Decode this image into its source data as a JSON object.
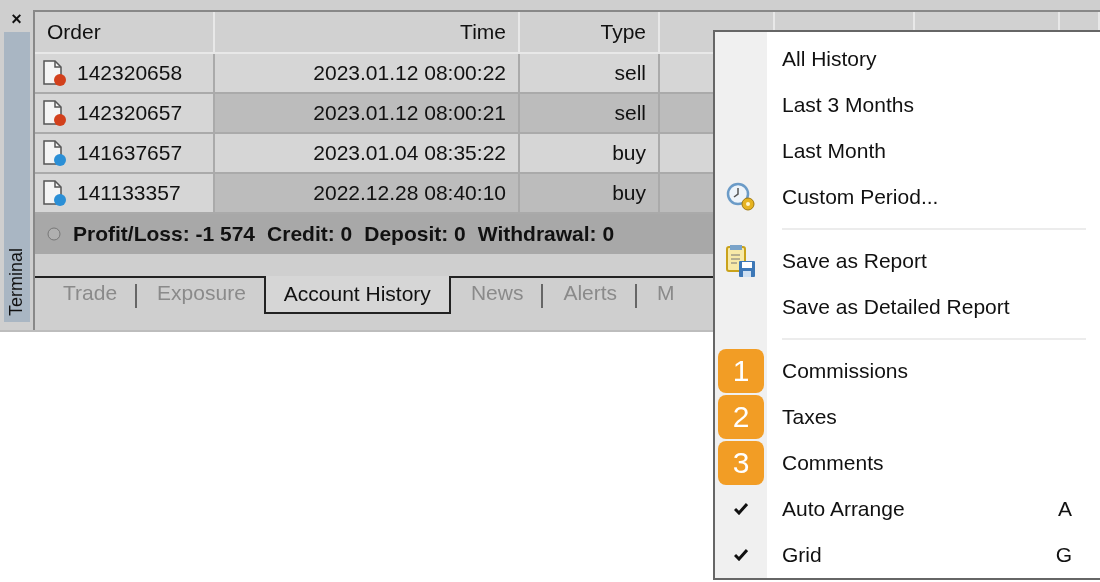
{
  "panel": {
    "title": "Terminal",
    "close": "×"
  },
  "table": {
    "columns": [
      {
        "label": "Order"
      },
      {
        "label": "Time"
      },
      {
        "label": "Type"
      },
      {},
      {},
      {},
      {}
    ],
    "rows": [
      {
        "order": "142320658",
        "time": "2023.01.12 08:00:22",
        "type": "sell",
        "color": "#d2401c"
      },
      {
        "order": "142320657",
        "time": "2023.01.12 08:00:21",
        "type": "sell",
        "color": "#d2401c"
      },
      {
        "order": "141637657",
        "time": "2023.01.04 08:35:22",
        "type": "buy",
        "color": "#2b8fd6"
      },
      {
        "order": "141133357",
        "time": "2022.12.28 08:40:10",
        "type": "buy",
        "color": "#2b8fd6"
      }
    ],
    "summary": [
      "Profit/Loss: -1 574",
      "Credit: 0",
      "Deposit: 0",
      "Withdrawal: 0"
    ]
  },
  "tabs": [
    {
      "label": "Trade",
      "selected": false
    },
    {
      "label": "Exposure",
      "selected": false
    },
    {
      "label": "Account History",
      "selected": true
    },
    {
      "label": "News",
      "selected": false
    },
    {
      "label": "Alerts",
      "selected": false
    },
    {
      "label": "M",
      "selected": false
    }
  ],
  "menu": {
    "items": [
      {
        "kind": "text",
        "label": "All History",
        "checked": false
      },
      {
        "kind": "text",
        "label": "Last 3 Months",
        "checked": false
      },
      {
        "kind": "text",
        "label": "Last Month",
        "checked": false
      },
      {
        "kind": "period",
        "label": "Custom Period...",
        "checked": false
      },
      {
        "kind": "separator"
      },
      {
        "kind": "save",
        "label": "Save as Report",
        "checked": false
      },
      {
        "kind": "text",
        "label": "Save as Detailed Report",
        "checked": false
      },
      {
        "kind": "separator"
      },
      {
        "kind": "badge",
        "badge": "1",
        "label": "Commissions",
        "checked": false
      },
      {
        "kind": "badge",
        "badge": "2",
        "label": "Taxes",
        "checked": false
      },
      {
        "kind": "badge",
        "badge": "3",
        "label": "Comments",
        "checked": false
      },
      {
        "kind": "text",
        "label": "Auto Arrange",
        "checked": true,
        "shortcut": "A"
      },
      {
        "kind": "text",
        "label": "Grid",
        "checked": true,
        "shortcut": "G"
      }
    ]
  }
}
